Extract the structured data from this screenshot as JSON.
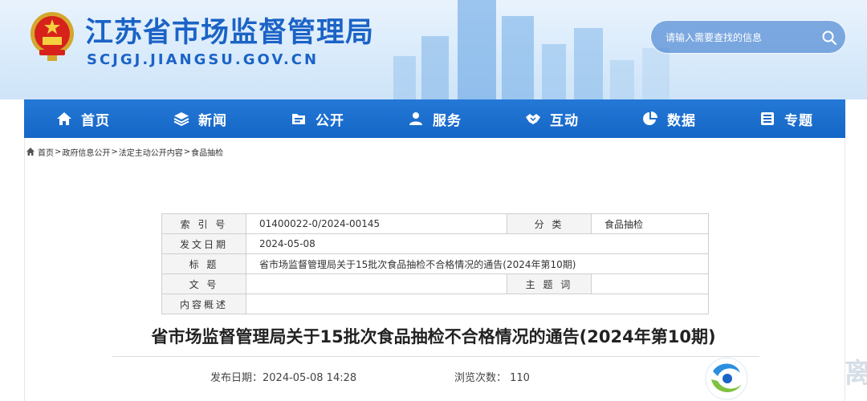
{
  "header": {
    "title": "江苏省市场监督管理局",
    "domain": "SCJGJ.JIANGSU.GOV.CN",
    "search_placeholder": "请输入需要查找的信息"
  },
  "nav": {
    "items": [
      {
        "label": "首页",
        "icon": "home-icon"
      },
      {
        "label": "新闻",
        "icon": "layers-icon"
      },
      {
        "label": "公开",
        "icon": "folder-icon"
      },
      {
        "label": "服务",
        "icon": "people-icon"
      },
      {
        "label": "互动",
        "icon": "handshake-icon"
      },
      {
        "label": "数据",
        "icon": "pie-chart-icon"
      },
      {
        "label": "专题",
        "icon": "list-icon"
      }
    ]
  },
  "breadcrumb": {
    "items": [
      "首页",
      "政府信息公开",
      "法定主动公开内容",
      "食品抽检"
    ],
    "separator": ">"
  },
  "info_table": {
    "index_label": "索 引 号",
    "index_value": "01400022-0/2024-00145",
    "category_label": "分 类",
    "category_value": "食品抽检",
    "date_label": "发文日期",
    "date_value": "2024-05-08",
    "subject_label": "标 题",
    "subject_value": "省市场监督管理局关于15批次食品抽检不合格情况的通告(2024年第10期)",
    "docno_label": "文 号",
    "docno_value": "",
    "keywords_label": "主 题 词",
    "keywords_value": "",
    "summary_label": "内容概述",
    "summary_value": ""
  },
  "article": {
    "title": "省市场监督管理局关于15批次食品抽检不合格情况的通告(2024年第10期)",
    "publish_time": "发布日期：2024-05-08 14:28",
    "views": "浏览次数： 110"
  },
  "colors": {
    "brand_blue": "#1b63c6",
    "nav_blue": "#1566c6"
  },
  "watermark": "离"
}
